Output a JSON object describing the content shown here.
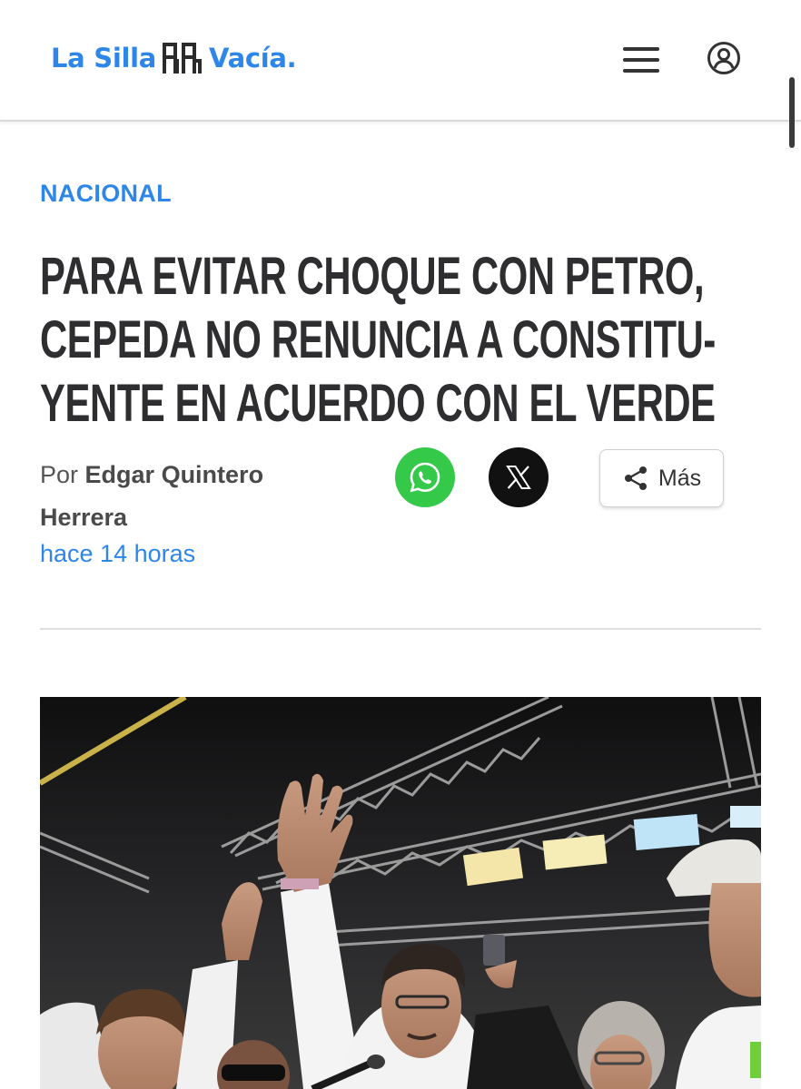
{
  "header": {
    "logo_text_left": "La Silla",
    "logo_text_right": "Vacía.",
    "menu_icon": "hamburger-menu-icon",
    "user_icon": "user-account-icon"
  },
  "article": {
    "category": "NACIONAL",
    "headline_lines": [
      "PARA EVITAR CHOQUE CON PETRO,",
      "CEPEDA NO RENUNCIA A CONSTITU-",
      "YENTE EN ACUERDO CON EL VERDE"
    ],
    "byline_prefix": "Por",
    "author": "Edgar Quintero Herrera",
    "published": "hace 14 horas",
    "share": {
      "whatsapp_icon": "whatsapp-icon",
      "x_icon": "x-twitter-icon",
      "more_label": "Más",
      "more_icon": "share-icon"
    },
    "hero_image": "photo-politician-rally-stage"
  },
  "colors": {
    "brand_blue": "#2f86e9",
    "headline": "#2e2d2f",
    "whatsapp_green": "#35c94a",
    "x_black": "#111111"
  }
}
